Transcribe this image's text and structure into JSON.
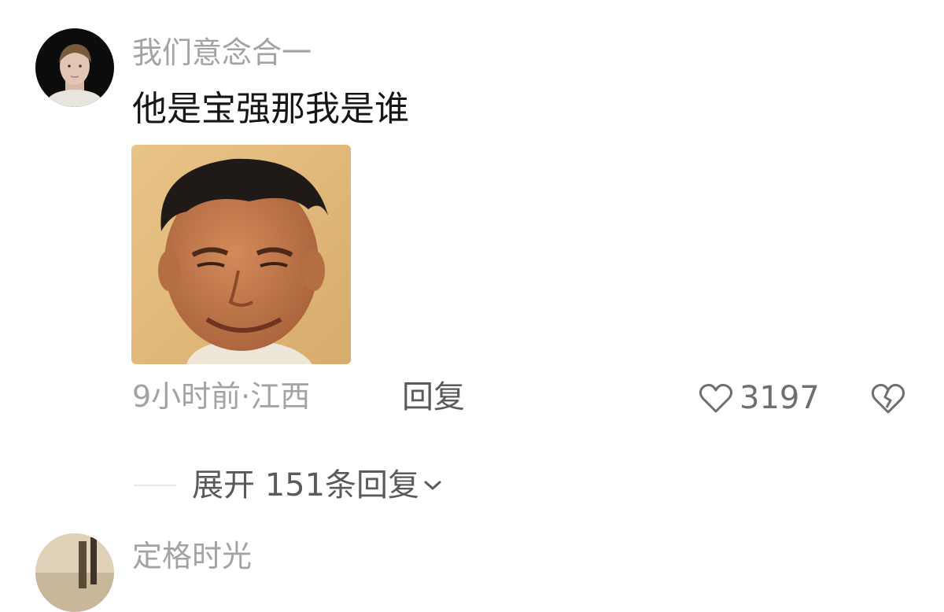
{
  "comments": [
    {
      "username": "我们意念合一",
      "text": "他是宝强那我是谁",
      "meta": "9小时前·江西",
      "reply_label": "回复",
      "like_count": "3197",
      "expand_label": "展开 151条回复"
    },
    {
      "username": "定格时光"
    }
  ],
  "icons": {
    "like": "heart-outline-icon",
    "dislike": "broken-heart-icon",
    "expand": "chevron-down-icon"
  },
  "colors": {
    "username": "#a3a3a3",
    "text": "#161616",
    "action": "#5a5a5a"
  }
}
